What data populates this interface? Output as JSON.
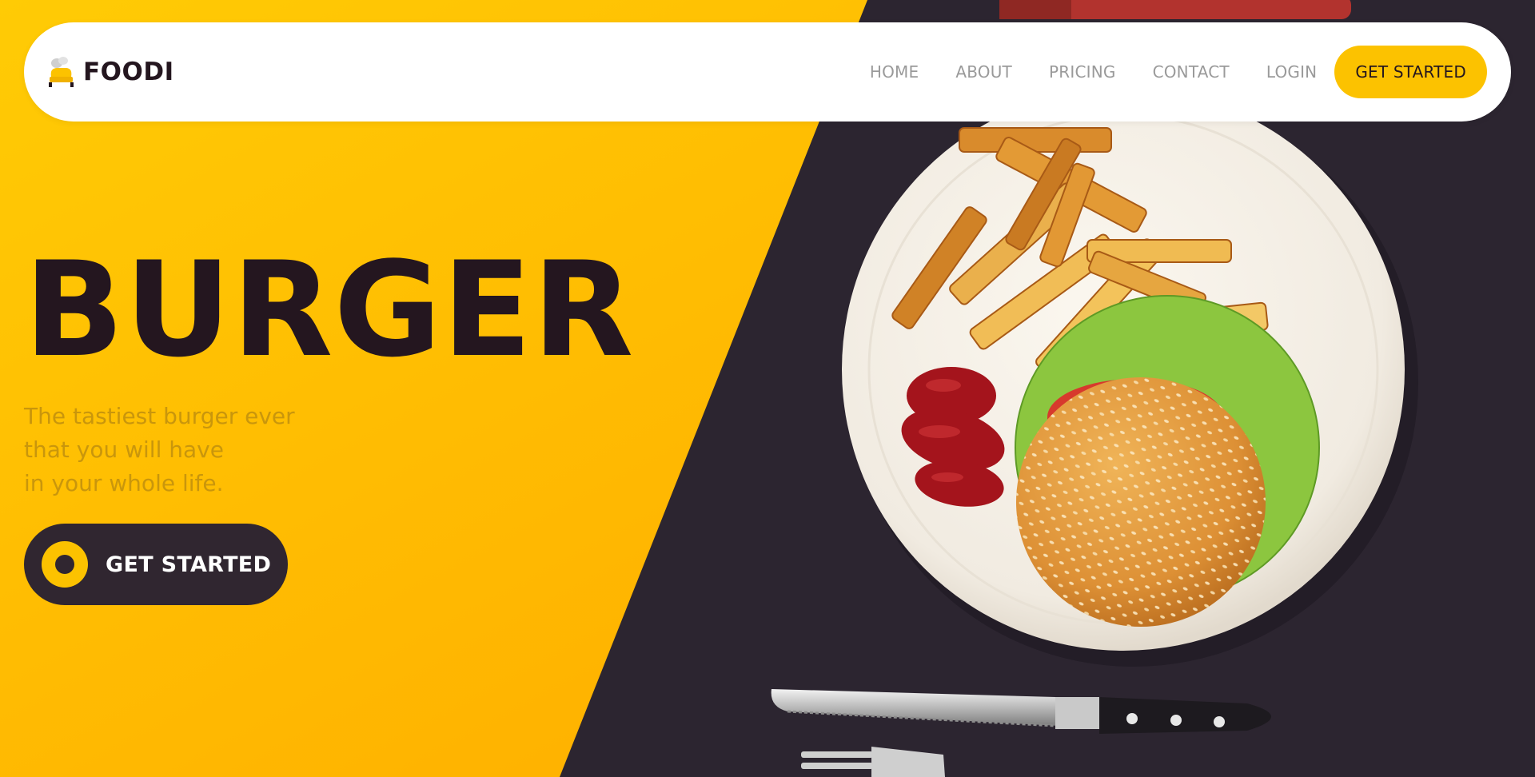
{
  "brand": {
    "name": "FOODI",
    "icon": "chef-hat-icon",
    "accent_color": "#fcc200",
    "dark_color": "#24161f"
  },
  "nav": {
    "links": [
      "HOME",
      "ABOUT",
      "PRICING",
      "CONTACT",
      "LOGIN"
    ],
    "cta_label": "GET STARTED"
  },
  "hero": {
    "title": "BURGER",
    "subtitle_lines": [
      "The tastiest burger ever",
      "that you will have",
      "in your whole life."
    ],
    "cta_label": "GET STARTED",
    "cta_icon": "ring-icon",
    "image_description_icon": "burger-plate-icon"
  }
}
